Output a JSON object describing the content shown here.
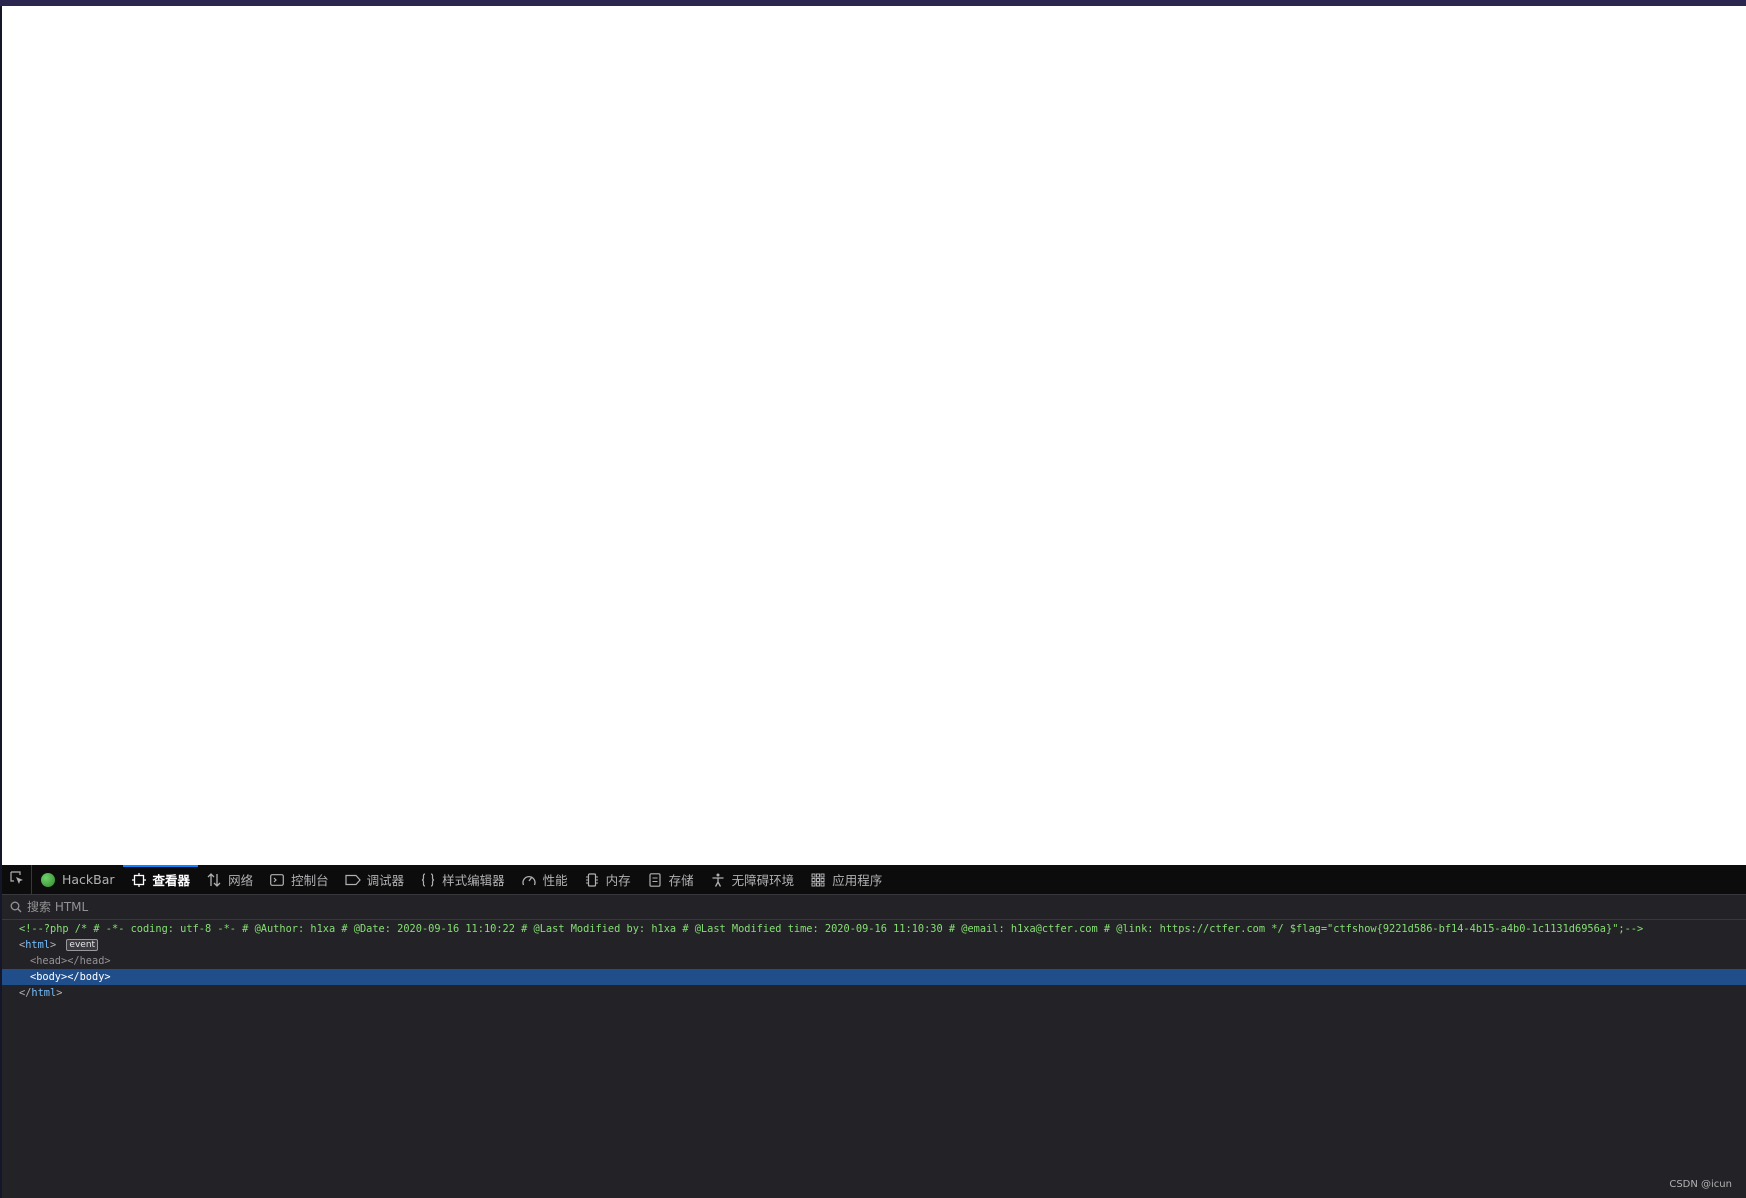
{
  "toolbar": {
    "tabs": [
      {
        "label": "HackBar",
        "icon": "hackbar-icon"
      },
      {
        "label": "查看器",
        "icon": "inspector-icon",
        "selected": true
      },
      {
        "label": "网络",
        "icon": "network-icon"
      },
      {
        "label": "控制台",
        "icon": "console-icon"
      },
      {
        "label": "调试器",
        "icon": "debugger-icon"
      },
      {
        "label": "样式编辑器",
        "icon": "style-editor-icon"
      },
      {
        "label": "性能",
        "icon": "performance-icon"
      },
      {
        "label": "内存",
        "icon": "memory-icon"
      },
      {
        "label": "存储",
        "icon": "storage-icon"
      },
      {
        "label": "无障碍环境",
        "icon": "accessibility-icon"
      },
      {
        "label": "应用程序",
        "icon": "application-icon"
      }
    ]
  },
  "search": {
    "placeholder": "搜索 HTML",
    "value": ""
  },
  "markup": {
    "comment": "<!--?php /* # -*- coding: utf-8 -*- # @Author: h1xa # @Date: 2020-09-16 11:10:22 # @Last Modified by: h1xa # @Last Modified time: 2020-09-16 11:10:30 # @email: h1xa@ctfer.com # @link: https://ctfer.com */ $flag=\"ctfshow{9221d586-bf14-4b15-a4b0-1c1131d6956a}\";-->",
    "html_open_tag": "html",
    "event_badge": "event",
    "head_element": "<head></head>",
    "body_element": "<body></body>",
    "html_close_tag": "html"
  },
  "watermark": "CSDN @icun",
  "colors": {
    "toolbar_bg": "#0c0c0d",
    "panel_bg": "#232327",
    "selected_row": "#204e8a",
    "accent": "#0a84ff",
    "comment": "#86de74",
    "tag": "#75bfff"
  }
}
